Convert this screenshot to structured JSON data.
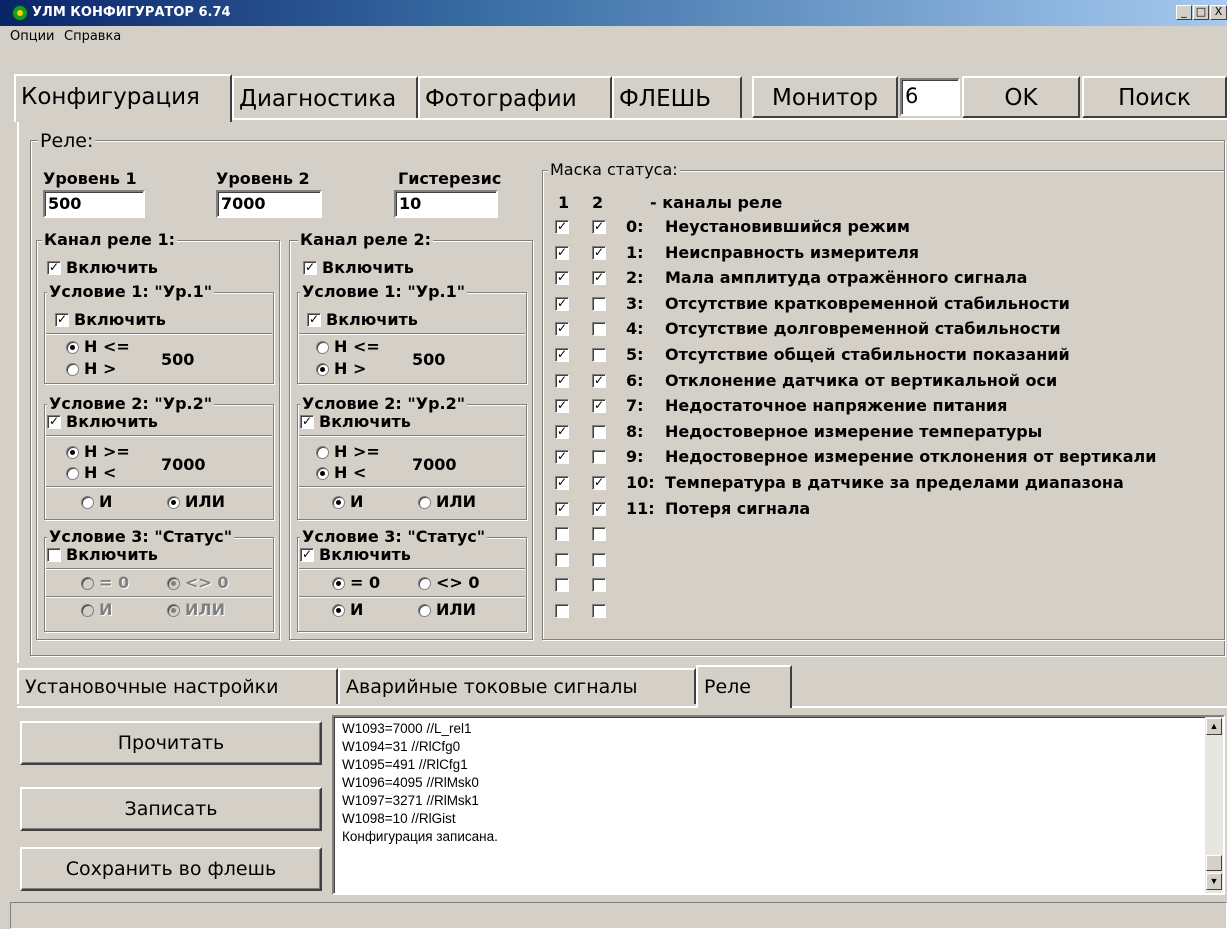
{
  "window": {
    "title": "УЛМ КОНФИГУРАТОР 6.74",
    "controls": [
      "_",
      "□",
      "X"
    ]
  },
  "menu": [
    "Опции",
    "Справка"
  ],
  "top_tabs": {
    "items": [
      "Конфигурация",
      "Диагностика",
      "Фотографии",
      "ФЛЕШЬ"
    ],
    "active": "Конфигурация"
  },
  "top_toolbar": {
    "monitor_label": "Монитор",
    "address_value": "6",
    "ok_label": "OK",
    "search_label": "Поиск"
  },
  "relay": {
    "group_title": "Реле:",
    "level1": {
      "label": "Уровень 1",
      "value": "500"
    },
    "level2": {
      "label": "Уровень 2",
      "value": "7000"
    },
    "hysteresis": {
      "label": "Гистерезис",
      "value": "10"
    },
    "channels": [
      {
        "title": "Канал реле 1:",
        "enable_label": "Включить",
        "enabled": true,
        "cond1": {
          "title": "Условие 1: \"Ур.1\"",
          "enable_label": "Включить",
          "enabled": true,
          "opt_a": "H <=",
          "opt_b": "H >",
          "selected": "a",
          "value": "500",
          "disabled": false
        },
        "cond2": {
          "title": "Условие 2: \"Ур.2\"",
          "enable_label": "Включить",
          "enabled": true,
          "opt_a": "H >=",
          "opt_b": "H <",
          "selected": "a",
          "value": "7000",
          "logic_a": "И",
          "logic_b": "ИЛИ",
          "logic_selected": "b"
        },
        "cond3": {
          "title": "Условие 3: \"Статус\"",
          "enable_label": "Включить",
          "enabled": false,
          "opt_a": "= 0",
          "opt_b": "<> 0",
          "selected": "b",
          "logic_a": "И",
          "logic_b": "ИЛИ",
          "logic_selected": "b",
          "disabled": true
        }
      },
      {
        "title": "Канал реле 2:",
        "enable_label": "Включить",
        "enabled": true,
        "cond1": {
          "title": "Условие 1: \"Ур.1\"",
          "enable_label": "Включить",
          "enabled": true,
          "opt_a": "H <=",
          "opt_b": "H >",
          "selected": "b",
          "value": "500",
          "disabled": false
        },
        "cond2": {
          "title": "Условие 2: \"Ур.2\"",
          "enable_label": "Включить",
          "enabled": true,
          "opt_a": "H >=",
          "opt_b": "H <",
          "selected": "b",
          "value": "7000",
          "logic_a": "И",
          "logic_b": "ИЛИ",
          "logic_selected": "a"
        },
        "cond3": {
          "title": "Условие 3: \"Статус\"",
          "enable_label": "Включить",
          "enabled": true,
          "opt_a": "= 0",
          "opt_b": "<> 0",
          "selected": "a",
          "logic_a": "И",
          "logic_b": "ИЛИ",
          "logic_selected": "a",
          "disabled": false
        }
      }
    ]
  },
  "status_mask": {
    "title": "Маска статуса:",
    "col1": "1",
    "col2": "2",
    "header_text": "- каналы реле",
    "rows": [
      {
        "code": "0:",
        "text": "Неустановившийся режим",
        "c1": true,
        "c2": true
      },
      {
        "code": "1:",
        "text": "Неисправность измерителя",
        "c1": true,
        "c2": true
      },
      {
        "code": "2:",
        "text": "Мала амплитуда отражённого сигнала",
        "c1": true,
        "c2": true
      },
      {
        "code": "3:",
        "text": "Отсутствие кратковременной стабильности",
        "c1": true,
        "c2": false
      },
      {
        "code": "4:",
        "text": "Отсутствие долговременной стабильности",
        "c1": true,
        "c2": false
      },
      {
        "code": "5:",
        "text": "Отсутствие общей стабильности показаний",
        "c1": true,
        "c2": false
      },
      {
        "code": "6:",
        "text": "Отклонение датчика от вертикальной оси",
        "c1": true,
        "c2": true
      },
      {
        "code": "7:",
        "text": "Недостаточное напряжение питания",
        "c1": true,
        "c2": true
      },
      {
        "code": "8:",
        "text": "Недостоверное измерение температуры",
        "c1": true,
        "c2": false
      },
      {
        "code": "9:",
        "text": "Недостоверное измерение отклонения от вертикали",
        "c1": true,
        "c2": false
      },
      {
        "code": "10:",
        "text": "Температура в датчике за пределами диапазона",
        "c1": true,
        "c2": true
      },
      {
        "code": "11:",
        "text": "Потеря сигнала",
        "c1": true,
        "c2": true
      },
      {
        "code": "",
        "text": "",
        "c1": false,
        "c2": false
      },
      {
        "code": "",
        "text": "",
        "c1": false,
        "c2": false
      },
      {
        "code": "",
        "text": "",
        "c1": false,
        "c2": false
      },
      {
        "code": "",
        "text": "",
        "c1": false,
        "c2": false
      }
    ]
  },
  "bottom_tabs": {
    "items": [
      "Установочные настройки",
      "Аварийные токовые сигналы",
      "Реле"
    ],
    "active": "Реле"
  },
  "actions": {
    "read_label": "Прочитать",
    "write_label": "Записать",
    "save_flash_label": "Сохранить во флешь"
  },
  "log": {
    "lines": [
      "W1093=7000 //L_rel1",
      "W1094=31 //RlCfg0",
      "W1095=491 //RlCfg1",
      "W1096=4095 //RlMsk0",
      "W1097=3271 //RlMsk1",
      "W1098=10 //RlGist",
      "Конфигурация записана."
    ],
    "scroll_up": "▲",
    "scroll_down": "▼"
  }
}
